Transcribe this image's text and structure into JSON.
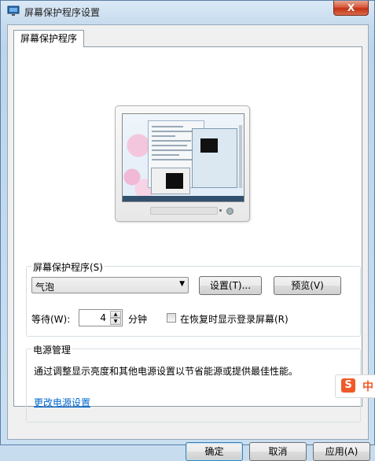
{
  "window": {
    "title": "屏幕保护程序设置",
    "close_label": "X"
  },
  "tab": {
    "label": "屏幕保护程序"
  },
  "screensaver": {
    "group_title": "屏幕保护程序(S)",
    "selected": "气泡",
    "settings_label": "设置(T)...",
    "preview_label": "预览(V)",
    "wait_label": "等待(W):",
    "wait_value": "4",
    "minutes_label": "分钟",
    "resume_checkbox_label": "在恢复时显示登录屏幕(R)",
    "resume_checked": false
  },
  "power": {
    "group_title": "电源管理",
    "description": "通过调整显示亮度和其他电源设置以节省能源或提供最佳性能。",
    "link_label": "更改电源设置"
  },
  "ime": {
    "logo": "S",
    "label": "中"
  },
  "buttons": {
    "ok": "确定",
    "cancel": "取消",
    "apply": "应用(A)"
  },
  "colors": {
    "link": "#0066cc",
    "close": "#c43215",
    "ime": "#f05a28"
  }
}
